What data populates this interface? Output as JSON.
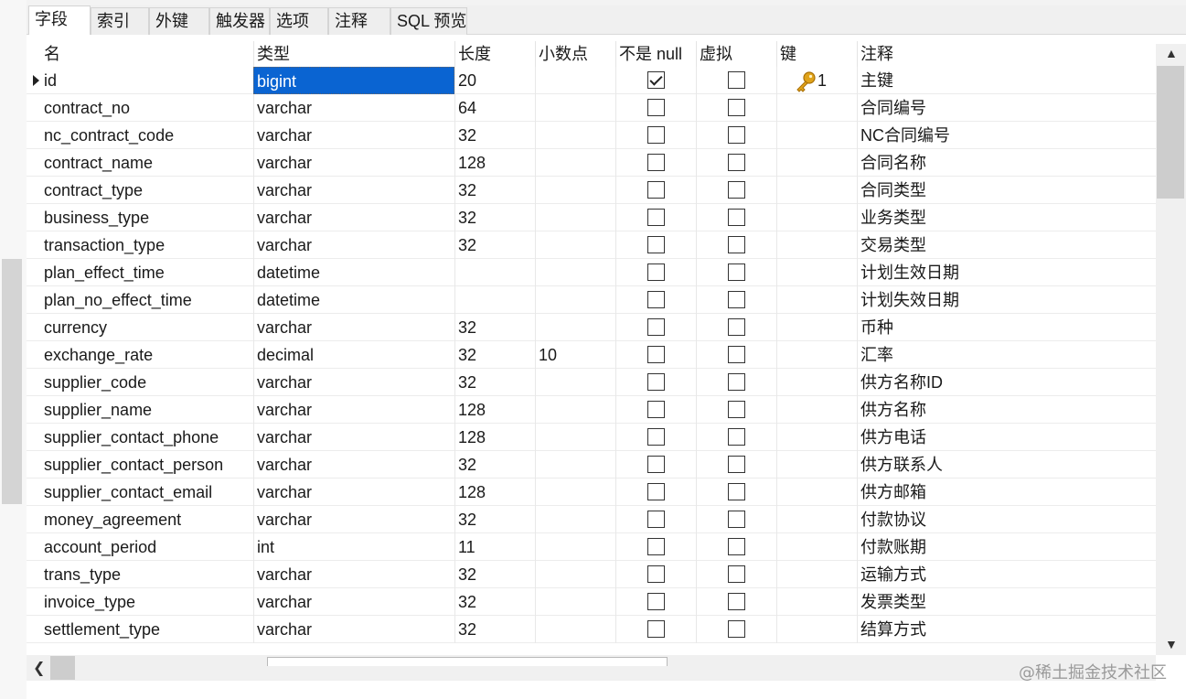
{
  "tabs": [
    {
      "label": "字段",
      "active": true
    },
    {
      "label": "索引"
    },
    {
      "label": "外键"
    },
    {
      "label": "触发器"
    },
    {
      "label": "选项"
    },
    {
      "label": "注释"
    },
    {
      "label": "SQL 预览"
    }
  ],
  "columns": {
    "name": "名",
    "type": "类型",
    "length": "长度",
    "decimal": "小数点",
    "not_null": "不是 null",
    "virtual": "虚拟",
    "key": "键",
    "comment": "注释"
  },
  "rows": [
    {
      "name": "id",
      "type": "bigint",
      "length": "20",
      "decimal": "",
      "not_null": true,
      "virtual": false,
      "key": "1",
      "comment": "主键"
    },
    {
      "name": "contract_no",
      "type": "varchar",
      "length": "64",
      "decimal": "",
      "not_null": false,
      "virtual": false,
      "key": "",
      "comment": "合同编号"
    },
    {
      "name": "nc_contract_code",
      "type": "varchar",
      "length": "32",
      "decimal": "",
      "not_null": false,
      "virtual": false,
      "key": "",
      "comment": "NC合同编号"
    },
    {
      "name": "contract_name",
      "type": "varchar",
      "length": "128",
      "decimal": "",
      "not_null": false,
      "virtual": false,
      "key": "",
      "comment": "合同名称"
    },
    {
      "name": "contract_type",
      "type": "varchar",
      "length": "32",
      "decimal": "",
      "not_null": false,
      "virtual": false,
      "key": "",
      "comment": "合同类型"
    },
    {
      "name": "business_type",
      "type": "varchar",
      "length": "32",
      "decimal": "",
      "not_null": false,
      "virtual": false,
      "key": "",
      "comment": "业务类型"
    },
    {
      "name": "transaction_type",
      "type": "varchar",
      "length": "32",
      "decimal": "",
      "not_null": false,
      "virtual": false,
      "key": "",
      "comment": "交易类型"
    },
    {
      "name": "plan_effect_time",
      "type": "datetime",
      "length": "",
      "decimal": "",
      "not_null": false,
      "virtual": false,
      "key": "",
      "comment": "计划生效日期"
    },
    {
      "name": "plan_no_effect_time",
      "type": "datetime",
      "length": "",
      "decimal": "",
      "not_null": false,
      "virtual": false,
      "key": "",
      "comment": "计划失效日期"
    },
    {
      "name": "currency",
      "type": "varchar",
      "length": "32",
      "decimal": "",
      "not_null": false,
      "virtual": false,
      "key": "",
      "comment": "币种"
    },
    {
      "name": "exchange_rate",
      "type": "decimal",
      "length": "32",
      "decimal": "10",
      "not_null": false,
      "virtual": false,
      "key": "",
      "comment": "汇率"
    },
    {
      "name": "supplier_code",
      "type": "varchar",
      "length": "32",
      "decimal": "",
      "not_null": false,
      "virtual": false,
      "key": "",
      "comment": "供方名称ID"
    },
    {
      "name": "supplier_name",
      "type": "varchar",
      "length": "128",
      "decimal": "",
      "not_null": false,
      "virtual": false,
      "key": "",
      "comment": "供方名称"
    },
    {
      "name": "supplier_contact_phone",
      "type": "varchar",
      "length": "128",
      "decimal": "",
      "not_null": false,
      "virtual": false,
      "key": "",
      "comment": "供方电话"
    },
    {
      "name": "supplier_contact_person",
      "type": "varchar",
      "length": "32",
      "decimal": "",
      "not_null": false,
      "virtual": false,
      "key": "",
      "comment": "供方联系人"
    },
    {
      "name": "supplier_contact_email",
      "type": "varchar",
      "length": "128",
      "decimal": "",
      "not_null": false,
      "virtual": false,
      "key": "",
      "comment": "供方邮箱"
    },
    {
      "name": "money_agreement",
      "type": "varchar",
      "length": "32",
      "decimal": "",
      "not_null": false,
      "virtual": false,
      "key": "",
      "comment": "付款协议"
    },
    {
      "name": "account_period",
      "type": "int",
      "length": "11",
      "decimal": "",
      "not_null": false,
      "virtual": false,
      "key": "",
      "comment": "付款账期"
    },
    {
      "name": "trans_type",
      "type": "varchar",
      "length": "32",
      "decimal": "",
      "not_null": false,
      "virtual": false,
      "key": "",
      "comment": "运输方式"
    },
    {
      "name": "invoice_type",
      "type": "varchar",
      "length": "32",
      "decimal": "",
      "not_null": false,
      "virtual": false,
      "key": "",
      "comment": "发票类型"
    },
    {
      "name": "settlement_type",
      "type": "varchar",
      "length": "32",
      "decimal": "",
      "not_null": false,
      "virtual": false,
      "key": "",
      "comment": "结算方式"
    }
  ],
  "selection": {
    "row": 0,
    "column": "type",
    "color": "#0a64d2"
  },
  "icons": {
    "key": "key-icon",
    "row_marker": "row-pointer-icon",
    "scroll_up": "chevron-up-icon",
    "scroll_down": "chevron-down-icon",
    "scroll_left": "chevron-left-icon"
  },
  "watermark": "@稀土掘金技术社区"
}
